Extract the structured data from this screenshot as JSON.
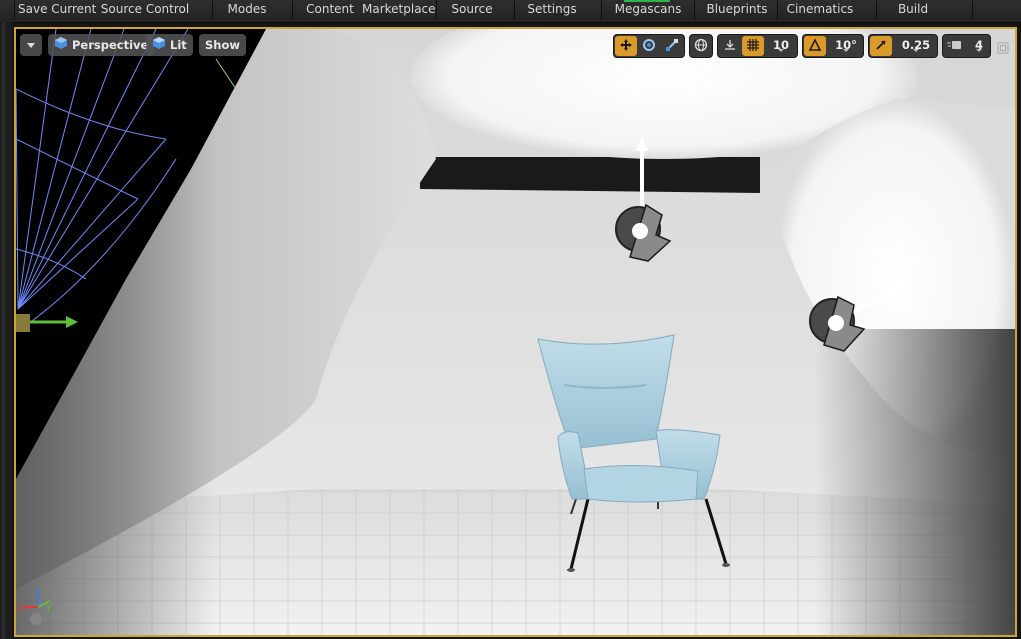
{
  "toolbar": {
    "items": [
      {
        "label": "Save Current"
      },
      {
        "label": "Source Control"
      },
      {
        "label": "Modes"
      },
      {
        "label": "Content"
      },
      {
        "label": "Marketplace"
      },
      {
        "label": "Source"
      },
      {
        "label": "Settings"
      },
      {
        "label": "Megascans"
      },
      {
        "label": "Blueprints"
      },
      {
        "label": "Cinematics"
      },
      {
        "label": "Build"
      }
    ],
    "accent_color": "#2fb34a"
  },
  "viewport": {
    "view_mode": "Perspective",
    "lit_mode": "Lit",
    "show_label": "Show",
    "grid_snap_value": "10",
    "rotation_snap_value": "10°",
    "scale_snap_value": "0.25",
    "camera_speed": "4",
    "highlight_color": "#d0a43a",
    "active_tool_color": "#d99a2a",
    "icons": [
      "translate-icon",
      "rotate-icon",
      "scale-icon",
      "world-local-icon",
      "surface-snap-icon",
      "grid-snap-icon",
      "rotation-snap-icon",
      "scale-snap-icon",
      "camera-speed-icon",
      "maximize-icon"
    ]
  },
  "scene": {
    "object": "armchair",
    "lights": [
      "spot-light-top",
      "spot-light-right"
    ],
    "chair_color": "#a9cfe0"
  }
}
